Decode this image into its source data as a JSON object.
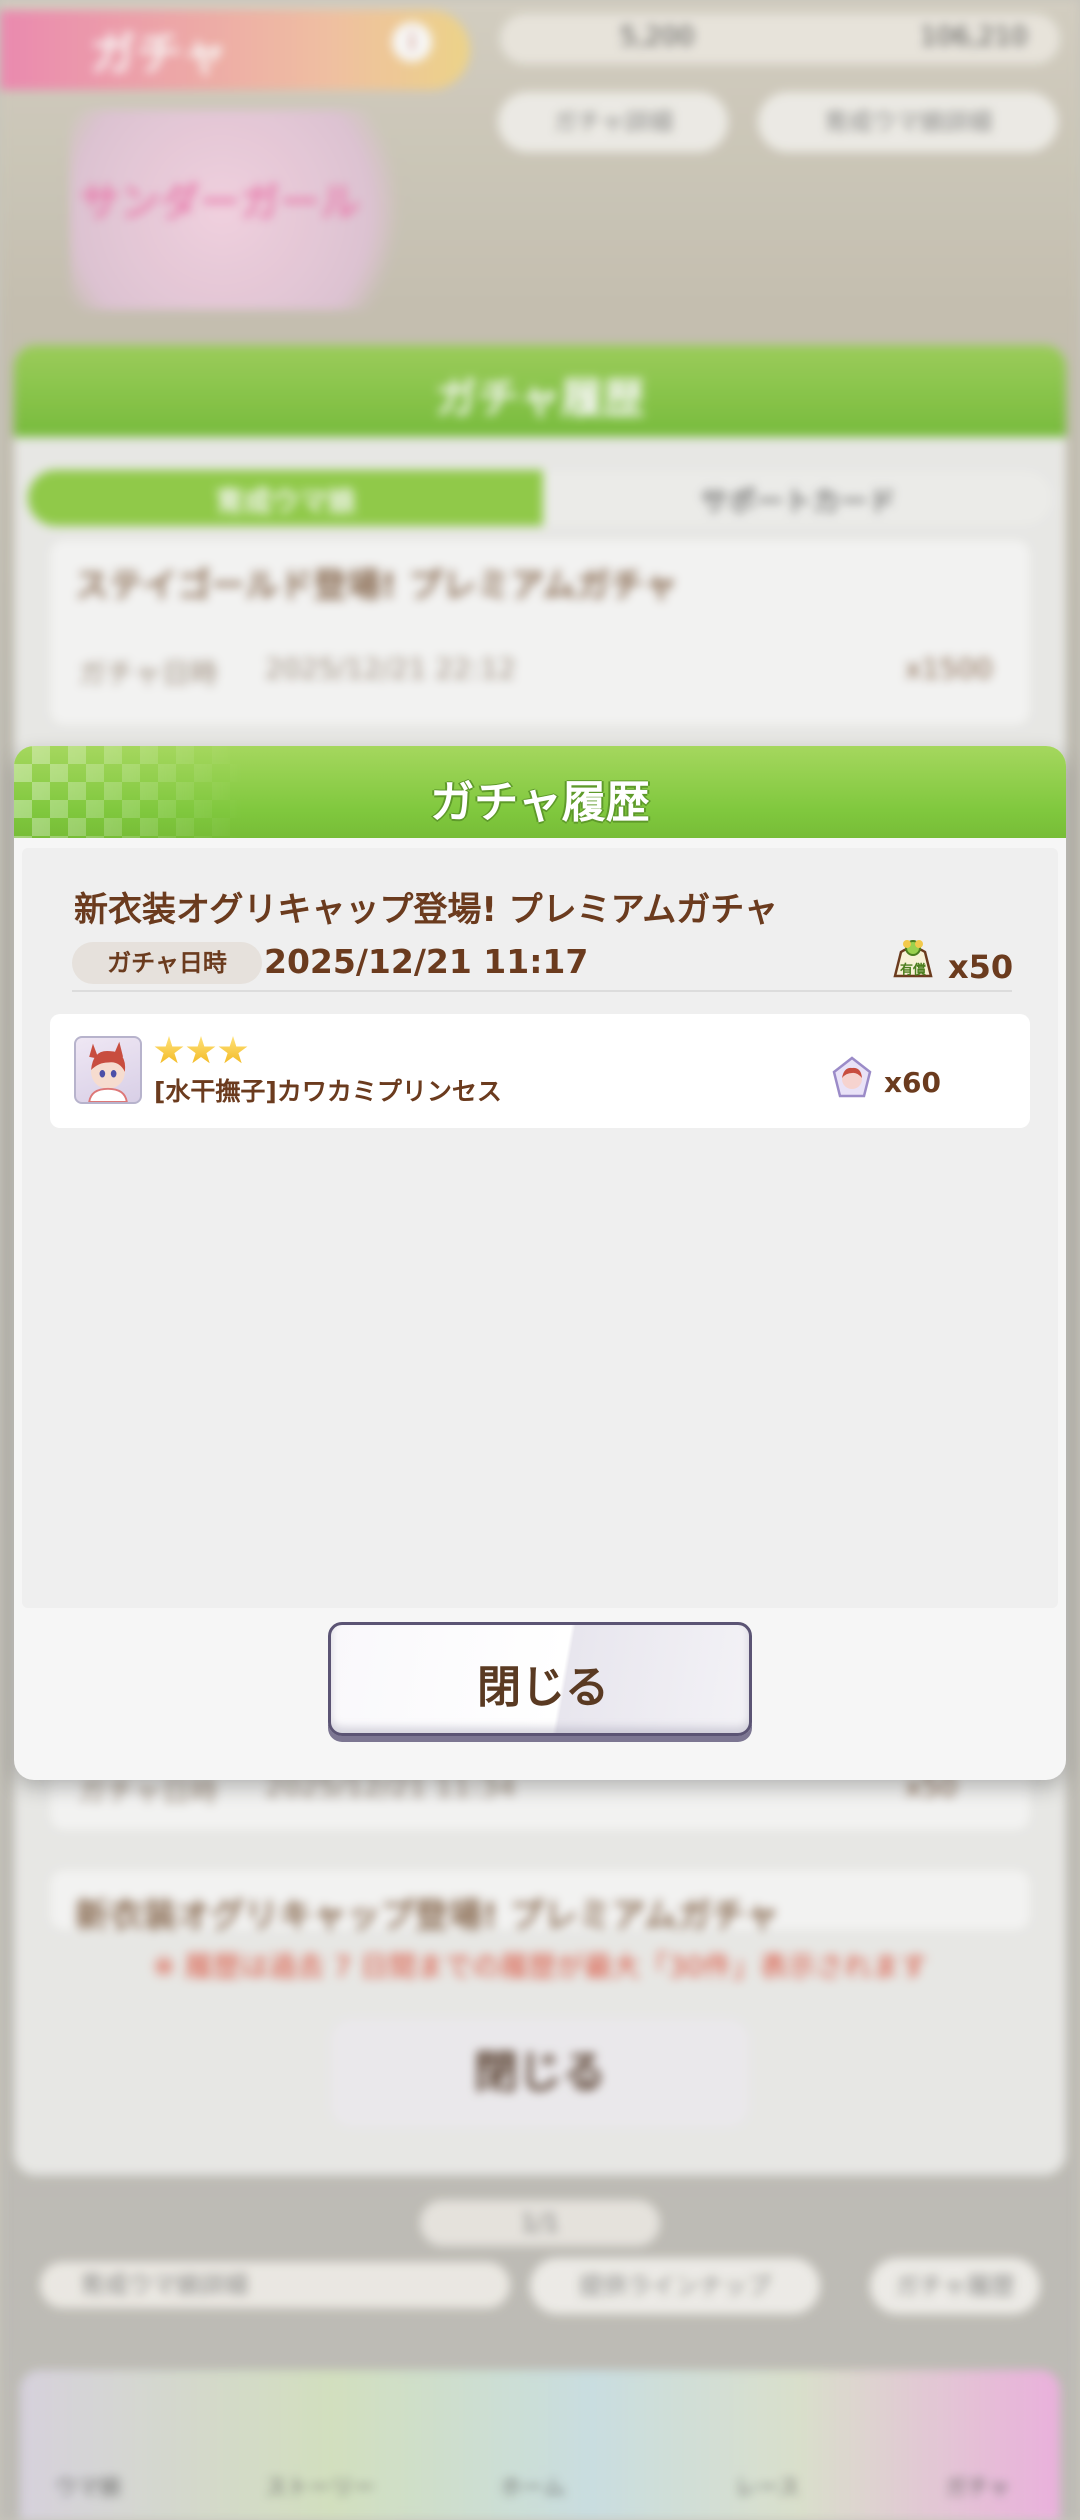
{
  "background": {
    "header_title": "ガチャ",
    "info_icon": "info-icon",
    "currency_a": "5,200",
    "currency_b": "106,210",
    "pill_left": "ガチャ詳細",
    "pill_right": "育成ウマ娘詳細",
    "banner_text": "サンダーガール",
    "panel_title": "ガチャ履歴",
    "tab_left": "育成ウマ娘",
    "tab_right": "サポートカード",
    "cards": [
      {
        "title": "ステイゴールド登場! プレミアムガチャ",
        "date_label": "ガチャ日時",
        "date": "2025/12/21 22:12",
        "amount": "x1500"
      },
      {
        "title": "",
        "date_label": "ガチャ日時",
        "date": "2025/12/21 11:34",
        "amount": "x50"
      },
      {
        "title": "新衣装オグリキャップ登場! プレミアムガチャ",
        "date_label": "",
        "date": "",
        "amount": ""
      }
    ],
    "note": "※ 履歴は過去 7 日間までの履歴が最大「30件」表示されます",
    "close_button": "閉じる",
    "page_indicator": "1/1",
    "bottom_buttons": [
      "育成ウマ娘詳細",
      "提供ラインナップ",
      "ガチャ履歴"
    ],
    "nav_labels": [
      "ウマ娘",
      "ストーリー",
      "ホーム",
      "レース",
      "ガチャ"
    ]
  },
  "modal": {
    "title": "ガチャ履歴",
    "gacha_name": "新衣装オグリキャップ登場! プレミアムガチャ",
    "date_label": "ガチャ日時",
    "date": "2025/12/21 11:17",
    "cost_icon": "ticket-icon",
    "cost": "x50",
    "results": [
      {
        "rarity_stars": 3,
        "name": "[水干撫子]カワカミプリンセス",
        "piece_icon": "piece-icon",
        "pieces": "x60"
      }
    ],
    "close_label": "閉じる"
  },
  "colors": {
    "accent_green": "#80c83e",
    "text_brown": "#6b3b1e",
    "star_gold": "#f2b820",
    "button_border": "#5b5474"
  }
}
